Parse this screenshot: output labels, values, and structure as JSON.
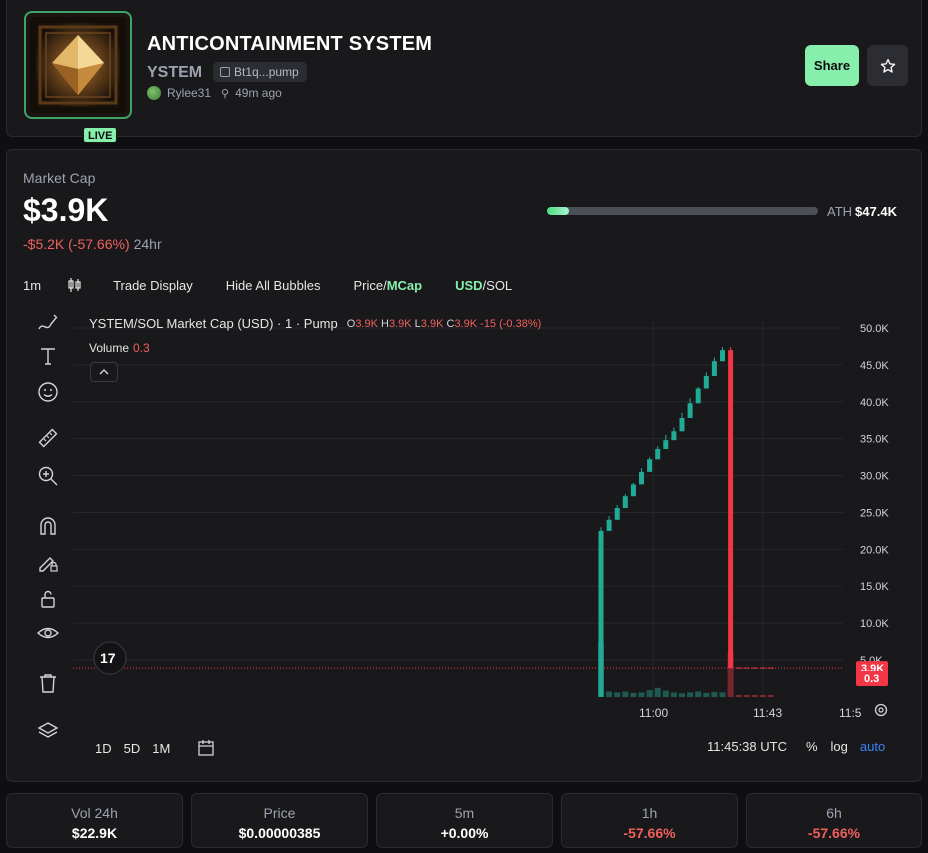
{
  "header": {
    "title": "ANTICONTAINMENT SYSTEM",
    "ticker": "YSTEM",
    "address": "Bt1q...pump",
    "creator": "Rylee31",
    "age": "49m ago",
    "live_label": "LIVE",
    "share_label": "Share",
    "icons": [
      "copy-icon",
      "sprout-icon",
      "star-icon"
    ]
  },
  "market": {
    "label": "Market Cap",
    "value": "$3.9K",
    "change": "-$5.2K (-57.66%)",
    "period": "24hr",
    "ath_label": "ATH",
    "ath_value": "$47.4K",
    "ath_progress": 0.08
  },
  "toolbar": {
    "interval": "1m",
    "trade_display": "Trade Display",
    "hide_bubbles": "Hide All Bubbles",
    "price_label": "Price/",
    "mcap_label": "MCap",
    "usd_label": "USD",
    "sol_label": "/SOL"
  },
  "legend": {
    "symbol": "YSTEM/SOL Market Cap (USD) · 1 · Pump",
    "o_label": "O",
    "o": "3.9K",
    "h_label": "H",
    "h": "3.9K",
    "l_label": "L",
    "l": "3.9K",
    "c_label": "C",
    "c": "3.9K",
    "chg": "-15 (-0.38%)",
    "volume_label": "Volume",
    "volume": "0.3"
  },
  "bottom": {
    "ranges": [
      "1D",
      "5D",
      "1M"
    ],
    "clock": "11:45:38 UTC",
    "percent": "%",
    "log": "log",
    "auto": "auto"
  },
  "stats": [
    {
      "label": "Vol 24h",
      "value": "$22.9K"
    },
    {
      "label": "Price",
      "value": "$0.00000385"
    },
    {
      "label": "5m",
      "value": "+0.00%"
    },
    {
      "label": "1h",
      "value": "-57.66%"
    },
    {
      "label": "6h",
      "value": "-57.66%"
    }
  ],
  "colors": {
    "up": "#22ab94",
    "down": "#f23645",
    "accent": "#86efac",
    "link": "#3b82f6"
  },
  "chart_data": {
    "type": "candlestick",
    "y_ticks": [
      "50.0K",
      "45.0K",
      "40.0K",
      "35.0K",
      "30.0K",
      "25.0K",
      "20.0K",
      "15.0K",
      "10.0K",
      "5.0K"
    ],
    "x_ticks": [
      "11:00",
      "11:43",
      "11:5"
    ],
    "last_price_label": "3.9K",
    "last_volume_label": "0.3",
    "ylim": [
      0,
      50000
    ],
    "candles": [
      {
        "o": 0,
        "h": 23000,
        "l": 0,
        "c": 22500
      },
      {
        "o": 22500,
        "h": 24500,
        "l": 22500,
        "c": 24000
      },
      {
        "o": 24000,
        "h": 26000,
        "l": 24000,
        "c": 25600
      },
      {
        "o": 25600,
        "h": 27500,
        "l": 25600,
        "c": 27200
      },
      {
        "o": 27200,
        "h": 29000,
        "l": 27200,
        "c": 28800
      },
      {
        "o": 28800,
        "h": 31000,
        "l": 28800,
        "c": 30500
      },
      {
        "o": 30500,
        "h": 32500,
        "l": 30500,
        "c": 32200
      },
      {
        "o": 32200,
        "h": 34000,
        "l": 32200,
        "c": 33600
      },
      {
        "o": 33600,
        "h": 35500,
        "l": 33600,
        "c": 34800
      },
      {
        "o": 34800,
        "h": 36500,
        "l": 34800,
        "c": 36000
      },
      {
        "o": 36000,
        "h": 38500,
        "l": 36000,
        "c": 37800
      },
      {
        "o": 37800,
        "h": 40500,
        "l": 37800,
        "c": 39800
      },
      {
        "o": 39800,
        "h": 42000,
        "l": 39800,
        "c": 41800
      },
      {
        "o": 41800,
        "h": 44000,
        "l": 41800,
        "c": 43500
      },
      {
        "o": 43500,
        "h": 46000,
        "l": 43500,
        "c": 45500
      },
      {
        "o": 45500,
        "h": 47400,
        "l": 45500,
        "c": 47000
      },
      {
        "o": 47000,
        "h": 47400,
        "l": 3900,
        "c": 3900
      }
    ],
    "volumes": [
      120,
      12,
      10,
      12,
      9,
      10,
      15,
      20,
      14,
      10,
      8,
      10,
      12,
      9,
      11,
      10,
      95
    ]
  }
}
